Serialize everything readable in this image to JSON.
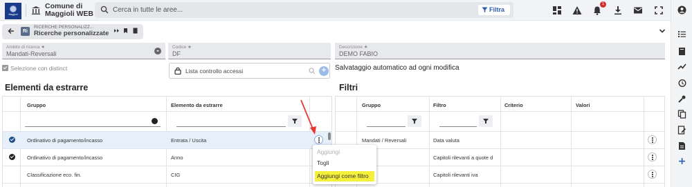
{
  "app": {
    "logo_text": "Maggioli",
    "title": "Comune di Maggioli WEB"
  },
  "search": {
    "placeholder": "Cerca in tutte le aree...",
    "filter_label": "Filtra"
  },
  "notifications": {
    "count": "1"
  },
  "tab": {
    "caption": "RICERCHE PERSONALIZZ...",
    "title": "Ricerche personalizzate",
    "app_icon_text": "Ri"
  },
  "form": {
    "ambito": {
      "label": "Ambito di ricerca ★",
      "value": "Mandati-Reversali"
    },
    "codice": {
      "label": "Codice ★",
      "value": "DF"
    },
    "descrizione": {
      "label": "Descrizione ★",
      "value": "DEMO FABIO"
    },
    "distinct_label": "Selezione con distinct",
    "acl_label": "Lista controllo accessi",
    "autosave_text": "Salvataggio automatico ad ogni modifica"
  },
  "left_section": {
    "title": "Elementi da estrarre",
    "columns": [
      "Gruppo",
      "Elemento da estrarre"
    ],
    "rows": [
      {
        "gruppo": "Ordinativo di pagamento/incasso",
        "elemento": "Entrata / Uscita",
        "checked": true,
        "selected": true
      },
      {
        "gruppo": "Ordinativo di pagamento/incasso",
        "elemento": "Anno",
        "checked": true,
        "selected": false
      },
      {
        "gruppo": "Classificazione eco. fin.",
        "elemento": "CIG",
        "checked": false,
        "selected": false
      }
    ]
  },
  "right_section": {
    "title": "Filtri",
    "columns": [
      "Gruppo",
      "Filtro",
      "Criterio",
      "Valori"
    ],
    "rows": [
      {
        "gruppo": "Mandati / Reversali",
        "filtro": "Data valuta"
      },
      {
        "gruppo": "",
        "filtro": "Capitoli rilevanti a quote d"
      },
      {
        "gruppo": "",
        "filtro": "Capitoli rilevanti iva"
      }
    ]
  },
  "context_menu": {
    "items": [
      {
        "label": "Aggiungi",
        "disabled": true,
        "highlighted": false
      },
      {
        "label": "Togli",
        "disabled": false,
        "highlighted": false
      },
      {
        "label": "Aggiungi come filtro",
        "disabled": false,
        "highlighted": true
      }
    ]
  },
  "colors": {
    "accent": "#2a5db0",
    "check_blue": "#1f4e8c",
    "highlight": "#f5f03a",
    "arrow": "#e53935",
    "badge": "#d32f2f"
  },
  "icons": {
    "topbar_right": [
      "dashboard-icon",
      "warning-icon",
      "bell-icon",
      "download-icon",
      "mail-icon",
      "fullscreen-icon"
    ],
    "sidebar": [
      "account-icon",
      "list-icon",
      "book-icon",
      "trend-icon",
      "history-icon",
      "tools-icon",
      "copy-icon",
      "edit-doc-icon",
      "pdf-icon",
      "plus-icon"
    ]
  }
}
